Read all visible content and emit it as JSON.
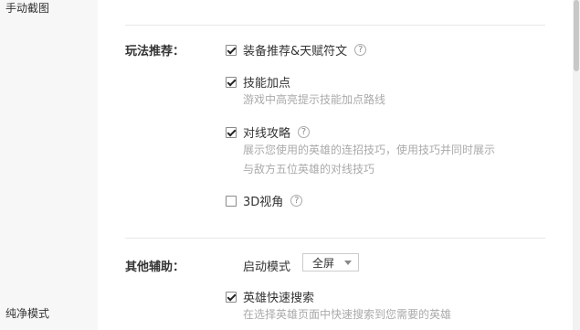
{
  "sidebar": {
    "items": [
      {
        "label": "手动截图"
      },
      {
        "label": "纯净模式"
      }
    ]
  },
  "sections": {
    "gameplay": {
      "label": "玩法推荐：",
      "options": [
        {
          "label": "装备推荐&天赋符文",
          "checked": true,
          "help": "?"
        },
        {
          "label": "技能加点",
          "checked": true,
          "desc": [
            "游戏中高亮提示技能加点路线"
          ]
        },
        {
          "label": "对线攻略",
          "checked": true,
          "help": "?",
          "desc": [
            "展示您使用的英雄的连招技巧，使用技巧并同时展示",
            "与敌方五位英雄的对线技巧"
          ]
        },
        {
          "label": "3D视角",
          "checked": false,
          "help": "?"
        }
      ]
    },
    "other": {
      "label": "其他辅助：",
      "launch_mode_label": "启动模式",
      "launch_mode_value": "全屏",
      "options": [
        {
          "label": "英雄快速搜索",
          "checked": true,
          "desc": [
            "在选择英雄页面中快速搜索到您需要的英雄"
          ]
        }
      ]
    }
  }
}
